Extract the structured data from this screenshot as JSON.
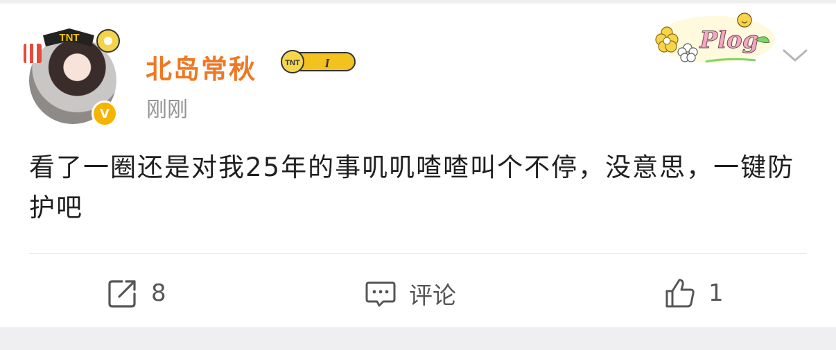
{
  "post": {
    "author": {
      "name": "北岛常秋",
      "level_badge_text": "TNT",
      "level_number": "I",
      "avatar_frame_text": "TNT"
    },
    "timestamp": "刚刚",
    "decoration_text": "Plog",
    "content": "看了一圈还是对我25年的事叽叽喳喳叫个不停，没意思，一键防护吧",
    "actions": {
      "repost_count": "8",
      "comment_label": "评论",
      "like_count": "1"
    }
  },
  "icons": {
    "more": "chevron-down-icon",
    "repost": "repost-icon",
    "comment": "comment-icon",
    "like": "thumbs-up-icon",
    "verified": "verified-v-icon"
  },
  "colors": {
    "username": "#f07823",
    "verified_badge": "#f6b400",
    "timestamp": "#939393",
    "text": "#1f1f1f",
    "background": "#efeff1"
  }
}
